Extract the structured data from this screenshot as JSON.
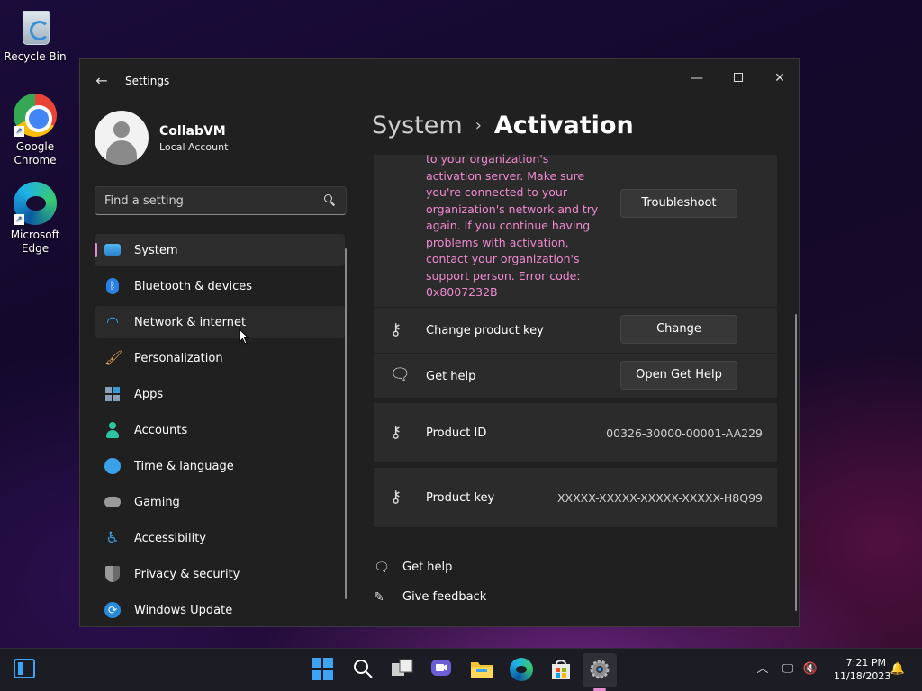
{
  "desktop": {
    "icons": [
      {
        "label": "Recycle Bin"
      },
      {
        "label": "Google Chrome"
      },
      {
        "label": "Microsoft Edge"
      }
    ]
  },
  "window": {
    "title": "Settings",
    "back_icon": "arrow-left-icon",
    "minimize_icon": "minimize-icon",
    "maximize_icon": "maximize-icon",
    "close_icon": "close-icon"
  },
  "profile": {
    "name": "CollabVM",
    "account_type": "Local Account"
  },
  "search": {
    "placeholder": "Find a setting"
  },
  "nav": {
    "items": [
      {
        "label": "System",
        "color": "#3a9ad9"
      },
      {
        "label": "Bluetooth & devices",
        "color": "#2a7fe0"
      },
      {
        "label": "Network & internet",
        "color": "#3aa0e8"
      },
      {
        "label": "Personalization",
        "color": "#e0a060"
      },
      {
        "label": "Apps",
        "color": "#8aa0b8"
      },
      {
        "label": "Accounts",
        "color": "#2ec4a0"
      },
      {
        "label": "Time & language",
        "color": "#3aa0e8"
      },
      {
        "label": "Gaming",
        "color": "#9a9a9a"
      },
      {
        "label": "Accessibility",
        "color": "#3a9ad9"
      },
      {
        "label": "Privacy & security",
        "color": "#8a8a8a"
      },
      {
        "label": "Windows Update",
        "color": "#2a8ad9"
      }
    ]
  },
  "header": {
    "parent": "System",
    "current": "Activation"
  },
  "activation": {
    "error_text": "to your organization's activation server. Make sure you're connected to your organization's network and try again. If you continue having problems with activation, contact your organization's support person. Error code: 0x8007232B",
    "troubleshoot_label": "Troubleshoot",
    "change_key_label": "Change product key",
    "change_button": "Change",
    "get_help_label": "Get help",
    "open_get_help_button": "Open Get Help",
    "product_id_label": "Product ID",
    "product_id_value": "00326-30000-00001-AA229",
    "product_key_label": "Product key",
    "product_key_value": "XXXXX-XXXXX-XXXXX-XXXXX-H8Q99"
  },
  "footer": {
    "get_help": "Get help",
    "give_feedback": "Give feedback"
  },
  "taskbar": {
    "time": "7:21 PM",
    "date": "11/18/2023"
  },
  "colors": {
    "accent": "#e38ad0",
    "error_text": "#f08ad0",
    "window_bg": "#202020",
    "card_bg": "#2b2b2b"
  }
}
